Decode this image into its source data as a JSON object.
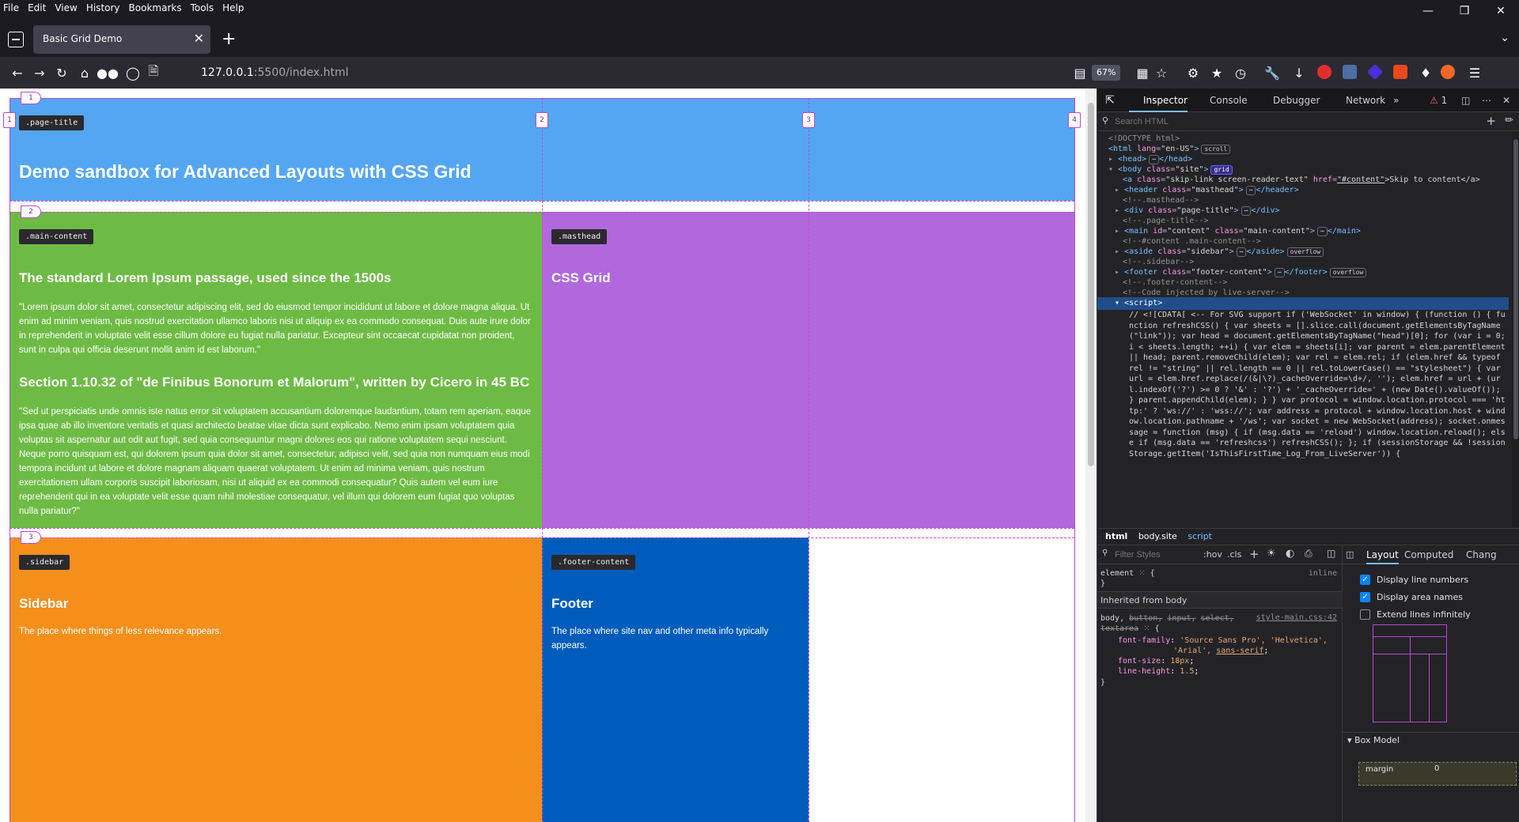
{
  "menu": [
    "File",
    "Edit",
    "View",
    "History",
    "Bookmarks",
    "Tools",
    "Help"
  ],
  "window_controls": {
    "minimize": "—",
    "restore": "❐",
    "close": "✕"
  },
  "tab": {
    "title": "Basic Grid Demo",
    "close": "✕",
    "new_tab": "+",
    "overflow": "⌄"
  },
  "navbar": {
    "url_host": "127.0.0.1",
    "url_rest": ":5500/index.html",
    "zoom": "67%"
  },
  "page": {
    "title_tag": ".page-title",
    "title": "Demo sandbox for Advanced Layouts with CSS Grid",
    "main_tag": ".main-content",
    "main_h2a": "The standard Lorem Ipsum passage, used since the 1500s",
    "main_p1": "\"Lorem ipsum dolor sit amet, consectetur adipiscing elit, sed do eiusmod tempor incididunt ut labore et dolore magna aliqua. Ut enim ad minim veniam, quis nostrud exercitation ullamco laboris nisi ut aliquip ex ea commodo consequat. Duis aute irure dolor in reprehenderit in voluptate velit esse cillum dolore eu fugiat nulla pariatur. Excepteur sint occaecat cupidatat non proident, sunt in culpa qui officia deserunt mollit anim id est laborum.\"",
    "main_h2b": "Section 1.10.32 of \"de Finibus Bonorum et Malorum\", written by Cicero in 45 BC",
    "main_p2": "\"Sed ut perspiciatis unde omnis iste natus error sit voluptatem accusantium doloremque laudantium, totam rem aperiam, eaque ipsa quae ab illo inventore veritatis et quasi architecto beatae vitae dicta sunt explicabo. Nemo enim ipsam voluptatem quia voluptas sit aspernatur aut odit aut fugit, sed quia consequuntur magni dolores eos qui ratione voluptatem sequi nesciunt. Neque porro quisquam est, qui dolorem ipsum quia dolor sit amet, consectetur, adipisci velit, sed quia non numquam eius modi tempora incidunt ut labore et dolore magnam aliquam quaerat voluptatem. Ut enim ad minima veniam, quis nostrum exercitationem ullam corporis suscipit laboriosam, nisi ut aliquid ex ea commodi consequatur? Quis autem vel eum iure reprehenderit qui in ea voluptate velit esse quam nihil molestiae consequatur, vel illum qui dolorem eum fugiat quo voluptas nulla pariatur?\"",
    "masthead_tag": ".masthead",
    "masthead_h2": "CSS Grid",
    "sidebar_tag": ".sidebar",
    "sidebar_h2": "Sidebar",
    "sidebar_p": "The place where things of less relevance appears.",
    "footer_tag": ".footer-content",
    "footer_h2": "Footer",
    "footer_p": "The place where site nav and other meta info typically appears."
  },
  "grid_numbers": {
    "c1": "1",
    "c2": "2",
    "c3": "3",
    "c4": "4",
    "r1": "1",
    "r2": "2",
    "r3": "3"
  },
  "devtools": {
    "tabs": {
      "inspector": "Inspector",
      "console": "Console",
      "debugger": "Debugger",
      "network": "Network",
      "error_count": "1"
    },
    "search_placeholder": "Search HTML",
    "markup": {
      "l1": "<!DOCTYPE html>",
      "l2_tag": "<html ",
      "l2_attr": "lang",
      "l2_val": "\"en-US\"",
      "l2_end": ">",
      "l2_badge": "scroll",
      "l3": "<head>",
      "l3_end": "</head>",
      "l4_tag": "<body ",
      "l4_attr": "class",
      "l4_val": "\"site\"",
      "l4_end": ">",
      "l4_badge": "grid",
      "l5_tag": "<a ",
      "l5_attr1": "class",
      "l5_val1": "\"skip-link screen-reader-text\"",
      "l5_attr2": "href",
      "l5_val2": "\"#content\"",
      "l5_text": ">Skip to content</a>",
      "l6_tag": "<header ",
      "l6_attr": "class",
      "l6_val": "\"masthead\"",
      "l6_end": "</header>",
      "l7": "<!--.masthead-->",
      "l8_tag": "<div ",
      "l8_attr": "class",
      "l8_val": "\"page-title\"",
      "l8_end": "</div>",
      "l9": "<!--.page-title-->",
      "l10_tag": "<main ",
      "l10_attr1": "id",
      "l10_val1": "\"content\"",
      "l10_attr2": "class",
      "l10_val2": "\"main-content\"",
      "l10_end": "</main>",
      "l11": "<!--#content .main-content-->",
      "l12_tag": "<aside ",
      "l12_attr": "class",
      "l12_val": "\"sidebar\"",
      "l12_end": "</aside>",
      "l12_badge": "overflow",
      "l13": "<!--.sidebar-->",
      "l14_tag": "<footer ",
      "l14_attr": "class",
      "l14_val": "\"footer-content\"",
      "l14_end": "</footer>",
      "l14_badge": "overflow",
      "l15": "<!--.footer-content-->",
      "l16": "<!--Code injected by live-server-->",
      "l17": "<script>",
      "script": "// <![CDATA[ <-- For SVG support if ('WebSocket' in window) { (function () { function refreshCSS() { var sheets = [].slice.call(document.getElementsByTagName(\"link\")); var head = document.getElementsByTagName(\"head\")[0]; for (var i = 0; i < sheets.length; ++i) { var elem = sheets[i]; var parent = elem.parentElement || head; parent.removeChild(elem); var rel = elem.rel; if (elem.href && typeof rel != \"string\" || rel.length == 0 || rel.toLowerCase() == \"stylesheet\") { var url = elem.href.replace(/(&|\\?)_cacheOverride=\\d+/, ''); elem.href = url + (url.indexOf('?') >= 0 ? '&' : '?') + '_cacheOverride=' + (new Date().valueOf()); } parent.appendChild(elem); } } var protocol = window.location.protocol === 'http:' ? 'ws://' : 'wss://'; var address = protocol + window.location.host + window.location.pathname + '/ws'; var socket = new WebSocket(address); socket.onmessage = function (msg) { if (msg.data == 'reload') window.location.reload(); else if (msg.data == 'refreshcss') refreshCSS(); }; if (sessionStorage && !sessionStorage.getItem('IsThisFirstTime_Log_From_LiveServer')) {"
    },
    "breadcrumb": [
      "html",
      "body.site",
      "script"
    ],
    "rules": {
      "filter_placeholder": "Filter Styles",
      "hov": ":hov",
      "cls": ".cls",
      "element_selector": "element",
      "element_brace": "{",
      "element_source": "inline",
      "close_brace": "}",
      "inherited": "Inherited from body",
      "sel_a": "body,",
      "sel_b": "button,",
      "sel_c": "input,",
      "sel_d": "select,",
      "sel_e": "textarea",
      "source": "style-main.css:42",
      "p1_name": "font-family",
      "p1_val": "'Source Sans Pro', 'Helvetica',",
      "p1_val2a": "'Arial',",
      "p1_val2b": "sans-serif",
      "p2_name": "font-size",
      "p2_val": "18px",
      "p3_name": "line-height",
      "p3_val": "1.5"
    },
    "layout": {
      "tab_layout": "Layout",
      "tab_computed": "Computed",
      "tab_changes": "Chang",
      "opt1": "Display line numbers",
      "opt2": "Display area names",
      "opt3": "Extend lines infinitely",
      "box_model": "Box Model",
      "margin_label": "margin",
      "margin_value": "0"
    }
  }
}
